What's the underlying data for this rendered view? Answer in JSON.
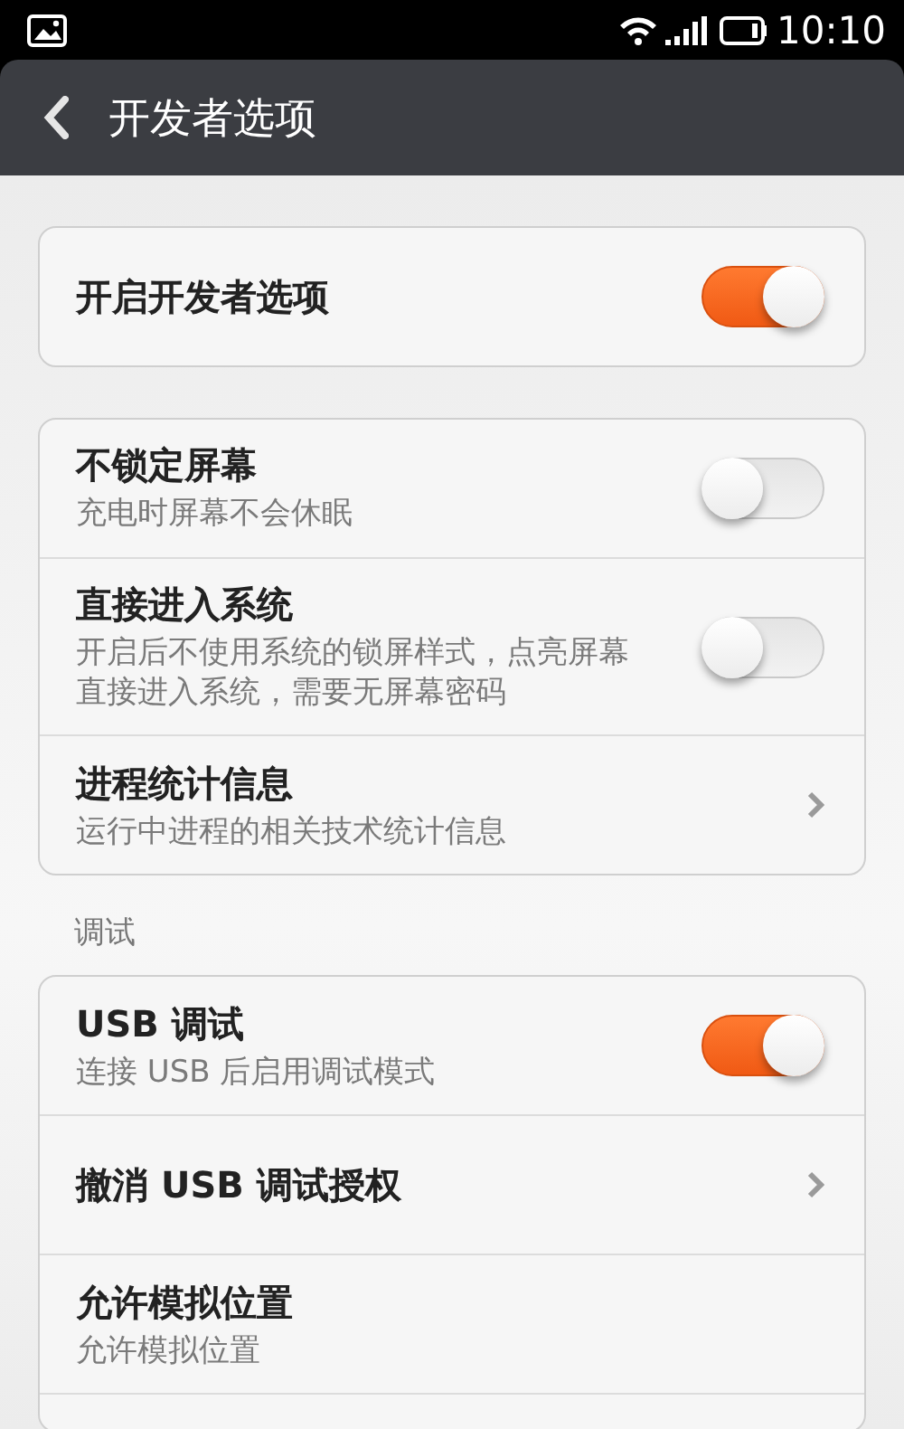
{
  "status_bar": {
    "time": "10:10"
  },
  "title_bar": {
    "title": "开发者选项"
  },
  "groups": [
    {
      "rows": [
        {
          "kind": "toggle",
          "title": "开启开发者选项",
          "on": true
        }
      ]
    },
    {
      "rows": [
        {
          "kind": "toggle",
          "title": "不锁定屏幕",
          "subtitle": "充电时屏幕不会休眠",
          "on": false
        },
        {
          "kind": "toggle",
          "title": "直接进入系统",
          "subtitle": "开启后不使用系统的锁屏样式，点亮屏幕直接进入系统，需要无屏幕密码",
          "on": false
        },
        {
          "kind": "link",
          "title": "进程统计信息",
          "subtitle": "运行中进程的相关技术统计信息"
        }
      ]
    },
    {
      "header": "调试",
      "rows": [
        {
          "kind": "toggle",
          "title": "USB 调试",
          "subtitle": "连接 USB 后启用调试模式",
          "on": true
        },
        {
          "kind": "link",
          "title": "撤消 USB 调试授权"
        },
        {
          "kind": "plain",
          "title": "允许模拟位置",
          "subtitle": "允许模拟位置"
        },
        {
          "kind": "cut-off"
        }
      ]
    }
  ]
}
